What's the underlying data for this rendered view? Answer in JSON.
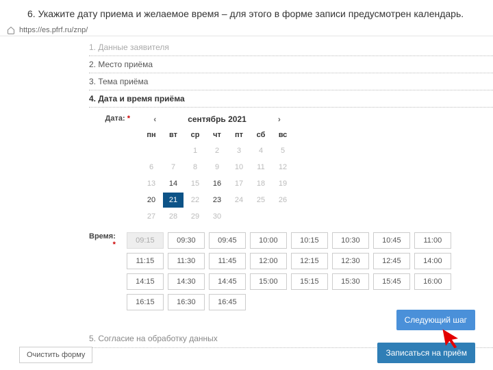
{
  "instruction": "6. Укажите дату приема и желаемое время – для этого в форме записи предусмотрен календарь.",
  "url": "https://es.pfrf.ru/znp/",
  "steps": {
    "s1": "1. Данные заявителя",
    "s2": "2. Место приёма",
    "s3": "3. Тема приёма",
    "s4": "4. Дата и время приёма",
    "s5": "5. Согласие на обработку данных"
  },
  "labels": {
    "date": "Дата:",
    "time": "Время:",
    "req": "*"
  },
  "calendar": {
    "month": "сентябрь 2021",
    "prev": "‹",
    "next": "›",
    "dow": [
      "пн",
      "вт",
      "ср",
      "чт",
      "пт",
      "сб",
      "вс"
    ],
    "days": [
      {
        "n": "",
        "c": ""
      },
      {
        "n": "",
        "c": ""
      },
      {
        "n": "1",
        "c": ""
      },
      {
        "n": "2",
        "c": ""
      },
      {
        "n": "3",
        "c": ""
      },
      {
        "n": "4",
        "c": ""
      },
      {
        "n": "5",
        "c": ""
      },
      {
        "n": "6",
        "c": ""
      },
      {
        "n": "7",
        "c": ""
      },
      {
        "n": "8",
        "c": ""
      },
      {
        "n": "9",
        "c": ""
      },
      {
        "n": "10",
        "c": ""
      },
      {
        "n": "11",
        "c": ""
      },
      {
        "n": "12",
        "c": ""
      },
      {
        "n": "13",
        "c": ""
      },
      {
        "n": "14",
        "c": "avail"
      },
      {
        "n": "15",
        "c": ""
      },
      {
        "n": "16",
        "c": "avail"
      },
      {
        "n": "17",
        "c": ""
      },
      {
        "n": "18",
        "c": ""
      },
      {
        "n": "19",
        "c": ""
      },
      {
        "n": "20",
        "c": "avail"
      },
      {
        "n": "21",
        "c": "sel"
      },
      {
        "n": "22",
        "c": ""
      },
      {
        "n": "23",
        "c": "avail"
      },
      {
        "n": "24",
        "c": ""
      },
      {
        "n": "25",
        "c": ""
      },
      {
        "n": "26",
        "c": ""
      },
      {
        "n": "27",
        "c": ""
      },
      {
        "n": "28",
        "c": ""
      },
      {
        "n": "29",
        "c": ""
      },
      {
        "n": "30",
        "c": ""
      }
    ]
  },
  "times": [
    {
      "t": "09:15",
      "d": true
    },
    {
      "t": "09:30",
      "d": false
    },
    {
      "t": "09:45",
      "d": false
    },
    {
      "t": "10:00",
      "d": false
    },
    {
      "t": "10:15",
      "d": false
    },
    {
      "t": "10:30",
      "d": false
    },
    {
      "t": "10:45",
      "d": false
    },
    {
      "t": "11:00",
      "d": false
    },
    {
      "t": "11:15",
      "d": false
    },
    {
      "t": "11:30",
      "d": false
    },
    {
      "t": "11:45",
      "d": false
    },
    {
      "t": "12:00",
      "d": false
    },
    {
      "t": "12:15",
      "d": false
    },
    {
      "t": "12:30",
      "d": false
    },
    {
      "t": "12:45",
      "d": false
    },
    {
      "t": "14:00",
      "d": false
    },
    {
      "t": "14:15",
      "d": false
    },
    {
      "t": "14:30",
      "d": false
    },
    {
      "t": "14:45",
      "d": false
    },
    {
      "t": "15:00",
      "d": false
    },
    {
      "t": "15:15",
      "d": false
    },
    {
      "t": "15:30",
      "d": false
    },
    {
      "t": "15:45",
      "d": false
    },
    {
      "t": "16:00",
      "d": false
    },
    {
      "t": "16:15",
      "d": false
    },
    {
      "t": "16:30",
      "d": false
    },
    {
      "t": "16:45",
      "d": false
    }
  ],
  "buttons": {
    "clear": "Очистить форму",
    "next": "Следующий шаг",
    "sign": "Записаться на приём"
  }
}
